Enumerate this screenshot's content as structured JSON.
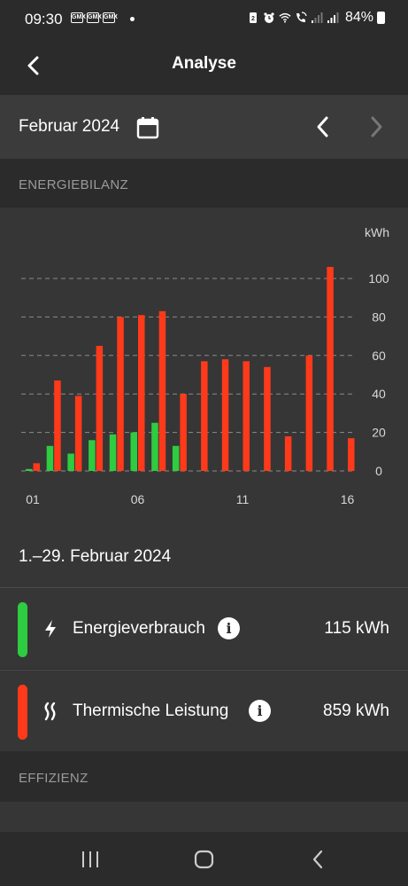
{
  "status_bar": {
    "time": "09:30",
    "notifications": [
      "GMX",
      "GMX",
      "GMX"
    ],
    "battery": "84%"
  },
  "app_bar": {
    "title": "Analyse"
  },
  "month_selector": {
    "label": "Februar 2024"
  },
  "sections": {
    "energy_balance": "ENERGIEBILANZ",
    "efficiency": "EFFIZIENZ"
  },
  "chart_data": {
    "type": "bar",
    "unit_label": "kWh",
    "ylim": [
      0,
      110
    ],
    "yticks": [
      0,
      20,
      40,
      60,
      80,
      100
    ],
    "xtick_labels": [
      "01",
      "06",
      "11",
      "16"
    ],
    "grid": true,
    "x": [
      1,
      2,
      3,
      4,
      5,
      6,
      7,
      8,
      9,
      10,
      11,
      12,
      13,
      14,
      15,
      16
    ],
    "series": [
      {
        "color": "#2ecc40",
        "values": [
          1,
          13,
          9,
          16,
          19,
          20,
          25,
          13,
          0,
          0,
          0,
          0,
          0,
          0,
          0,
          0
        ]
      },
      {
        "color": "#ff3a1a",
        "values": [
          4,
          47,
          39,
          65,
          80,
          81,
          83,
          40,
          57,
          58,
          57,
          54,
          18,
          60,
          106,
          17
        ]
      }
    ]
  },
  "range_label": "1.–29. Februar 2024",
  "summary": [
    {
      "label": "Energieverbrauch",
      "value": "115 kWh",
      "color": "#2ecc40",
      "icon": "lightning-icon"
    },
    {
      "label": "Thermische Leistung",
      "value": "859 kWh",
      "color": "#ff3a1a",
      "icon": "heat-waves-icon"
    }
  ]
}
